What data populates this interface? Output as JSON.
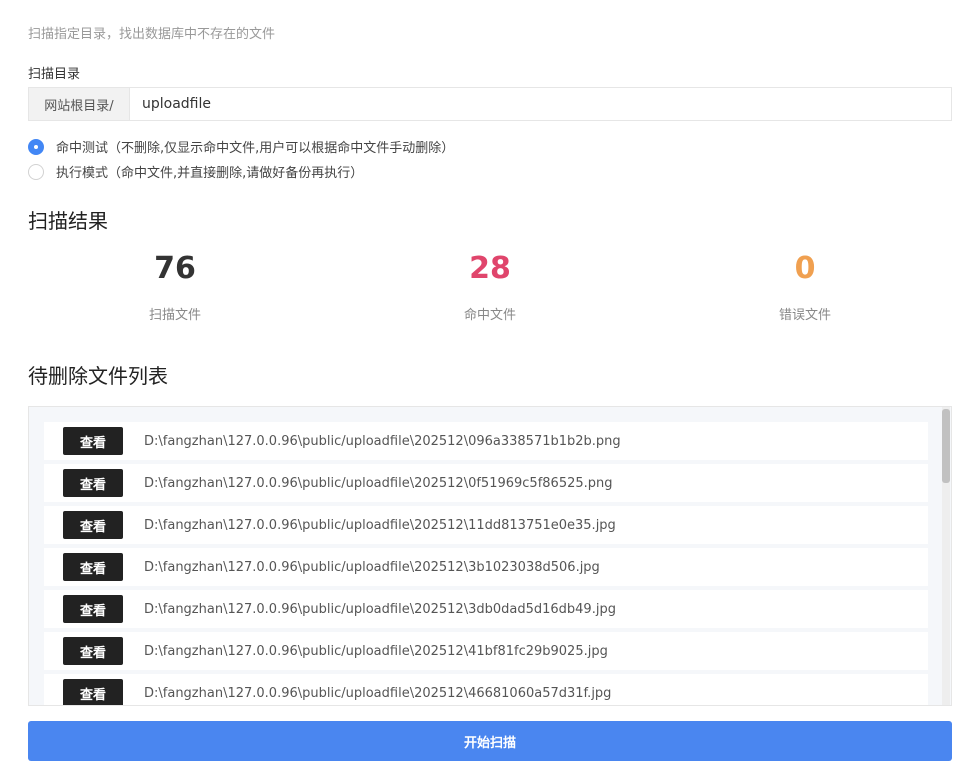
{
  "description": "扫描指定目录，找出数据库中不存在的文件",
  "scan_dir": {
    "label": "扫描目录",
    "prefix": "网站根目录/",
    "value": "uploadfile"
  },
  "modes": [
    {
      "label": "命中测试（不删除,仅显示命中文件,用户可以根据命中文件手动删除）",
      "checked": true
    },
    {
      "label": "执行模式（命中文件,并直接删除,请做好备份再执行）",
      "checked": false
    }
  ],
  "results": {
    "title": "扫描结果",
    "stats": [
      {
        "value": "76",
        "label": "扫描文件",
        "color": "#333333"
      },
      {
        "value": "28",
        "label": "命中文件",
        "color": "#e0456c"
      },
      {
        "value": "0",
        "label": "错误文件",
        "color": "#f0a050"
      }
    ]
  },
  "file_list": {
    "title": "待删除文件列表",
    "view_label": "查看",
    "files": [
      "D:\\fangzhan\\127.0.0.96\\public/uploadfile\\202512\\096a338571b1b2b.png",
      "D:\\fangzhan\\127.0.0.96\\public/uploadfile\\202512\\0f51969c5f86525.png",
      "D:\\fangzhan\\127.0.0.96\\public/uploadfile\\202512\\11dd813751e0e35.jpg",
      "D:\\fangzhan\\127.0.0.96\\public/uploadfile\\202512\\3b1023038d506.jpg",
      "D:\\fangzhan\\127.0.0.96\\public/uploadfile\\202512\\3db0dad5d16db49.jpg",
      "D:\\fangzhan\\127.0.0.96\\public/uploadfile\\202512\\41bf81fc29b9025.jpg",
      "D:\\fangzhan\\127.0.0.96\\public/uploadfile\\202512\\46681060a57d31f.jpg"
    ]
  },
  "start_button": "开始扫描",
  "colors": {
    "primary": "#4a86f0",
    "radio_checked": "#4287f5",
    "view_button": "#222222"
  }
}
